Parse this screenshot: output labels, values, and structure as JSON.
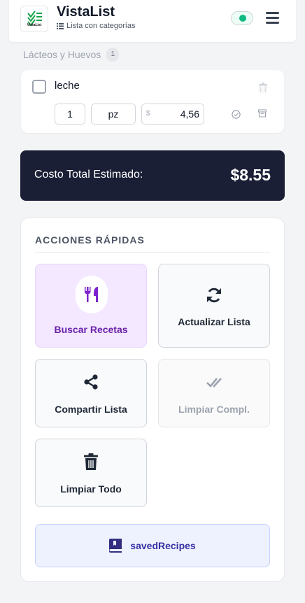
{
  "header": {
    "logo_text": "VistaList",
    "title": "VistaList",
    "subtitle": "Lista con categorías",
    "status_color": "#10b981"
  },
  "category": {
    "name": "Lácteos y Huevos",
    "count": "1"
  },
  "items": [
    {
      "name": "leche",
      "checked": false,
      "quantity": "1",
      "unit": "pz",
      "currency_symbol": "$",
      "price": "4,56"
    }
  ],
  "total": {
    "label": "Costo Total Estimado:",
    "value": "$8.55"
  },
  "actions": {
    "title": "ACCIONES RÁPIDAS",
    "search_recipes": "Buscar Recetas",
    "update_list": "Actualizar Lista",
    "share_list": "Compartir Lista",
    "clear_completed": "Limpiar Compl.",
    "clear_all": "Limpiar Todo",
    "saved_recipes": "savedRecipes"
  },
  "colors": {
    "accent_purple": "#7e22ce",
    "accent_indigo": "#312e81",
    "dark_card": "#1a1f36",
    "logo_green": "#16a34a"
  },
  "icons": {
    "logo": "check-list-icon",
    "menu": "hamburger-icon",
    "delete": "trash-icon",
    "check": "check-circle-icon",
    "archive": "archive-icon",
    "recipes": "utensils-icon",
    "update": "refresh-icon",
    "share": "share-icon",
    "clear_completed": "double-check-icon",
    "clear_all": "trash-icon",
    "saved": "book-icon"
  }
}
